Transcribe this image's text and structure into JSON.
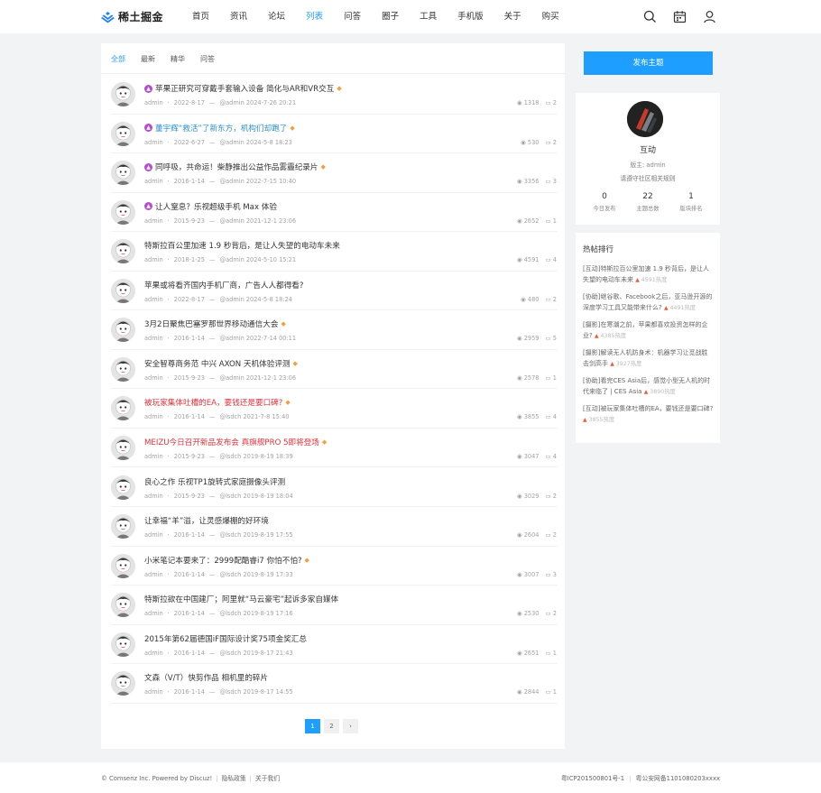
{
  "header": {
    "logo_text": "稀土掘金",
    "nav": [
      "首页",
      "资讯",
      "论坛",
      "列表",
      "问答",
      "圈子",
      "工具",
      "手机版",
      "关于",
      "购买"
    ],
    "active_nav": "列表"
  },
  "tabs": [
    "全部",
    "最新",
    "精华",
    "问答"
  ],
  "threads": [
    {
      "title": "苹果正研究可穿戴手套输入设备 简化与AR和VR交互",
      "color": "normal",
      "up": true,
      "gem": true,
      "author": "admin",
      "date": "2022-8-17",
      "last": "@admin 2024-7-26 20:21",
      "views": "1318",
      "replies": "2"
    },
    {
      "title": "董宇辉“救活”了新东方，机构们却跑了",
      "color": "blue",
      "up": true,
      "gem": true,
      "author": "admin",
      "date": "2022-6-27",
      "last": "@admin 2024-5-8 18:23",
      "views": "530",
      "replies": "2"
    },
    {
      "title": "同呼吸，共命运！柴静推出公益作品雾霾纪录片",
      "color": "normal",
      "up": true,
      "gem": true,
      "author": "admin",
      "date": "2016-1-14",
      "last": "@admin 2022-7-15 10:40",
      "views": "3356",
      "replies": "3"
    },
    {
      "title": "让人窒息？乐视超级手机 Max 体验",
      "color": "normal",
      "up": true,
      "gem": false,
      "author": "admin",
      "date": "2015-9-23",
      "last": "@admin 2021-12-1 23:06",
      "views": "2652",
      "replies": "1"
    },
    {
      "title": "特斯拉百公里加速 1.9 秒背后，是让人失望的电动车未来",
      "color": "normal",
      "up": false,
      "gem": false,
      "author": "admin",
      "date": "2018-1-25",
      "last": "@admin 2024-5-10 15:21",
      "views": "4591",
      "replies": "4"
    },
    {
      "title": "苹果或将看齐国内手机厂商，广告人人都得看?",
      "color": "normal",
      "up": false,
      "gem": false,
      "author": "admin",
      "date": "2022-8-17",
      "last": "@admin 2024-5-8 18:24",
      "views": "480",
      "replies": "2"
    },
    {
      "title": "3月2日聚焦巴塞罗那世界移动通信大会",
      "color": "normal",
      "up": false,
      "gem": true,
      "author": "admin",
      "date": "2016-1-14",
      "last": "@admin 2022-7-14 00:11",
      "views": "2959",
      "replies": "5"
    },
    {
      "title": "安全智尊商务范 中兴 AXON 天机体验评测",
      "color": "normal",
      "up": false,
      "gem": true,
      "author": "admin",
      "date": "2015-9-23",
      "last": "@admin 2021-12-1 23:06",
      "views": "2578",
      "replies": "1"
    },
    {
      "title": "被玩家集体吐槽的EA，要钱还是要口碑?",
      "color": "red",
      "up": false,
      "gem": true,
      "author": "admin",
      "date": "2016-1-14",
      "last": "@lsdch 2021-7-8 15:40",
      "views": "3855",
      "replies": "4"
    },
    {
      "title": "MEIZU今日召开新品发布会 真旗舰PRO 5即将登场",
      "color": "red",
      "up": false,
      "gem": true,
      "author": "admin",
      "date": "2015-9-23",
      "last": "@lsdch 2019-8-19 18:39",
      "views": "3047",
      "replies": "4"
    },
    {
      "title": "良心之作 乐视TP1旋转式家庭摄像头评测",
      "color": "normal",
      "up": false,
      "gem": false,
      "author": "admin",
      "date": "2015-9-23",
      "last": "@lsdch 2019-8-19 18:04",
      "views": "3029",
      "replies": "2"
    },
    {
      "title": "让幸福“羊”溢，让灵感爆棚的好环境",
      "color": "normal",
      "up": false,
      "gem": false,
      "author": "admin",
      "date": "2016-1-14",
      "last": "@lsdch 2019-8-19 17:55",
      "views": "2604",
      "replies": "2"
    },
    {
      "title": "小米笔记本要来了：2999配酷睿i7 你怕不怕?",
      "color": "normal",
      "up": false,
      "gem": true,
      "author": "admin",
      "date": "2016-1-14",
      "last": "@lsdch 2019-8-19 17:33",
      "views": "3007",
      "replies": "3"
    },
    {
      "title": "特斯拉欲在中国建厂；阿里就“马云豪宅”起诉多家自媒体",
      "color": "normal",
      "up": false,
      "gem": false,
      "author": "admin",
      "date": "2016-1-14",
      "last": "@lsdch 2019-8-19 17:16",
      "views": "2530",
      "replies": "2"
    },
    {
      "title": "2015年第62届德国iF国际设计奖75项金奖汇总",
      "color": "normal",
      "up": false,
      "gem": false,
      "author": "admin",
      "date": "2016-1-14",
      "last": "@lsdch 2019-8-17 21:43",
      "views": "2651",
      "replies": "1"
    },
    {
      "title": "文森（V/T）快剪作品 相机里的碎片",
      "color": "normal",
      "up": false,
      "gem": false,
      "author": "admin",
      "date": "2016-1-14",
      "last": "@lsdch 2019-8-17 14:55",
      "views": "2844",
      "replies": "1"
    }
  ],
  "pagination": {
    "pages": [
      "1",
      "2"
    ],
    "current": "1",
    "next": "›"
  },
  "sidebar": {
    "post_button": "发布主题",
    "forum": {
      "name": "互动",
      "moderator_label": "版主:",
      "moderator": "admin",
      "rule": "请遵守社区相关规则",
      "stats": [
        {
          "num": "0",
          "label": "今日发布"
        },
        {
          "num": "22",
          "label": "主题总数"
        },
        {
          "num": "1",
          "label": "版块排名"
        }
      ]
    },
    "hot": {
      "title": "热帖排行",
      "items": [
        {
          "text": "[互动]特斯拉百公里加速 1.9 秒背后，是让人失望的电动车未来",
          "heat": "4591热度"
        },
        {
          "text": "[协助]继谷歌、Facebook之后，亚马逊开源的深度学习工具又能带来什么?",
          "heat": "4491热度"
        },
        {
          "text": "[摄影]在寒潮之前，苹果都喜欢投资怎样的企业?",
          "heat": "4385热度"
        },
        {
          "text": "[摄影]解读无人机防身术：机器学习让觅战胜击剑高手",
          "heat": "3927热度"
        },
        {
          "text": "[协助]看完CES Asia后，感觉小型无人机的时代来临了 | CES Asia",
          "heat": "3890热度"
        },
        {
          "text": "[互动]被玩家集体吐槽的EA，要钱还是要口碑?",
          "heat": "3855热度"
        }
      ]
    }
  },
  "footer": {
    "copyright": "© Comsenz Inc. Powered by Discuz!",
    "privacy": "隐私政策",
    "about": "关于我们",
    "icp": "粤ICP20150080​1号-1",
    "police": "粤公安网备1101080203xxxx"
  },
  "colors": {
    "accent": "#1e9fff",
    "blue_title": "#2b8fd0",
    "red_title": "#e0303a",
    "up_badge": "#b74cd1"
  },
  "icons": {
    "search": "search-icon",
    "calendar": "calendar-icon",
    "user": "user-icon",
    "views": "eye-icon",
    "replies": "comment-icon"
  }
}
